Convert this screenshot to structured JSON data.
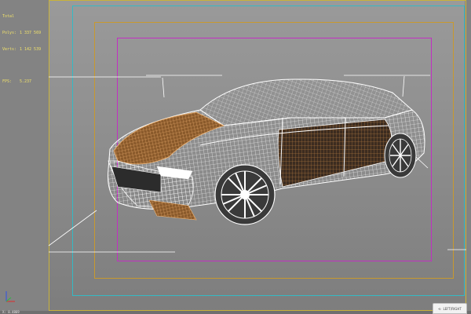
{
  "viewport": {
    "stats": {
      "heading": "Total",
      "polys_label": "Polys:",
      "polys_value": "1 337 569",
      "verts_label": "Verts:",
      "verts_value": "1 142 539",
      "fps_label": "FPS:",
      "fps_value": "5.237"
    },
    "coord_readout": "X: 0.4869",
    "navcube_label": "LEFT/RIGHT",
    "colors": {
      "frame_outer": "#c9b23a",
      "frame_cyan": "#34b9c4",
      "frame_orange": "#c8992e",
      "frame_magenta": "#c22fc2",
      "wire_white": "#ffffff",
      "wire_orange": "#d8a25a"
    }
  }
}
